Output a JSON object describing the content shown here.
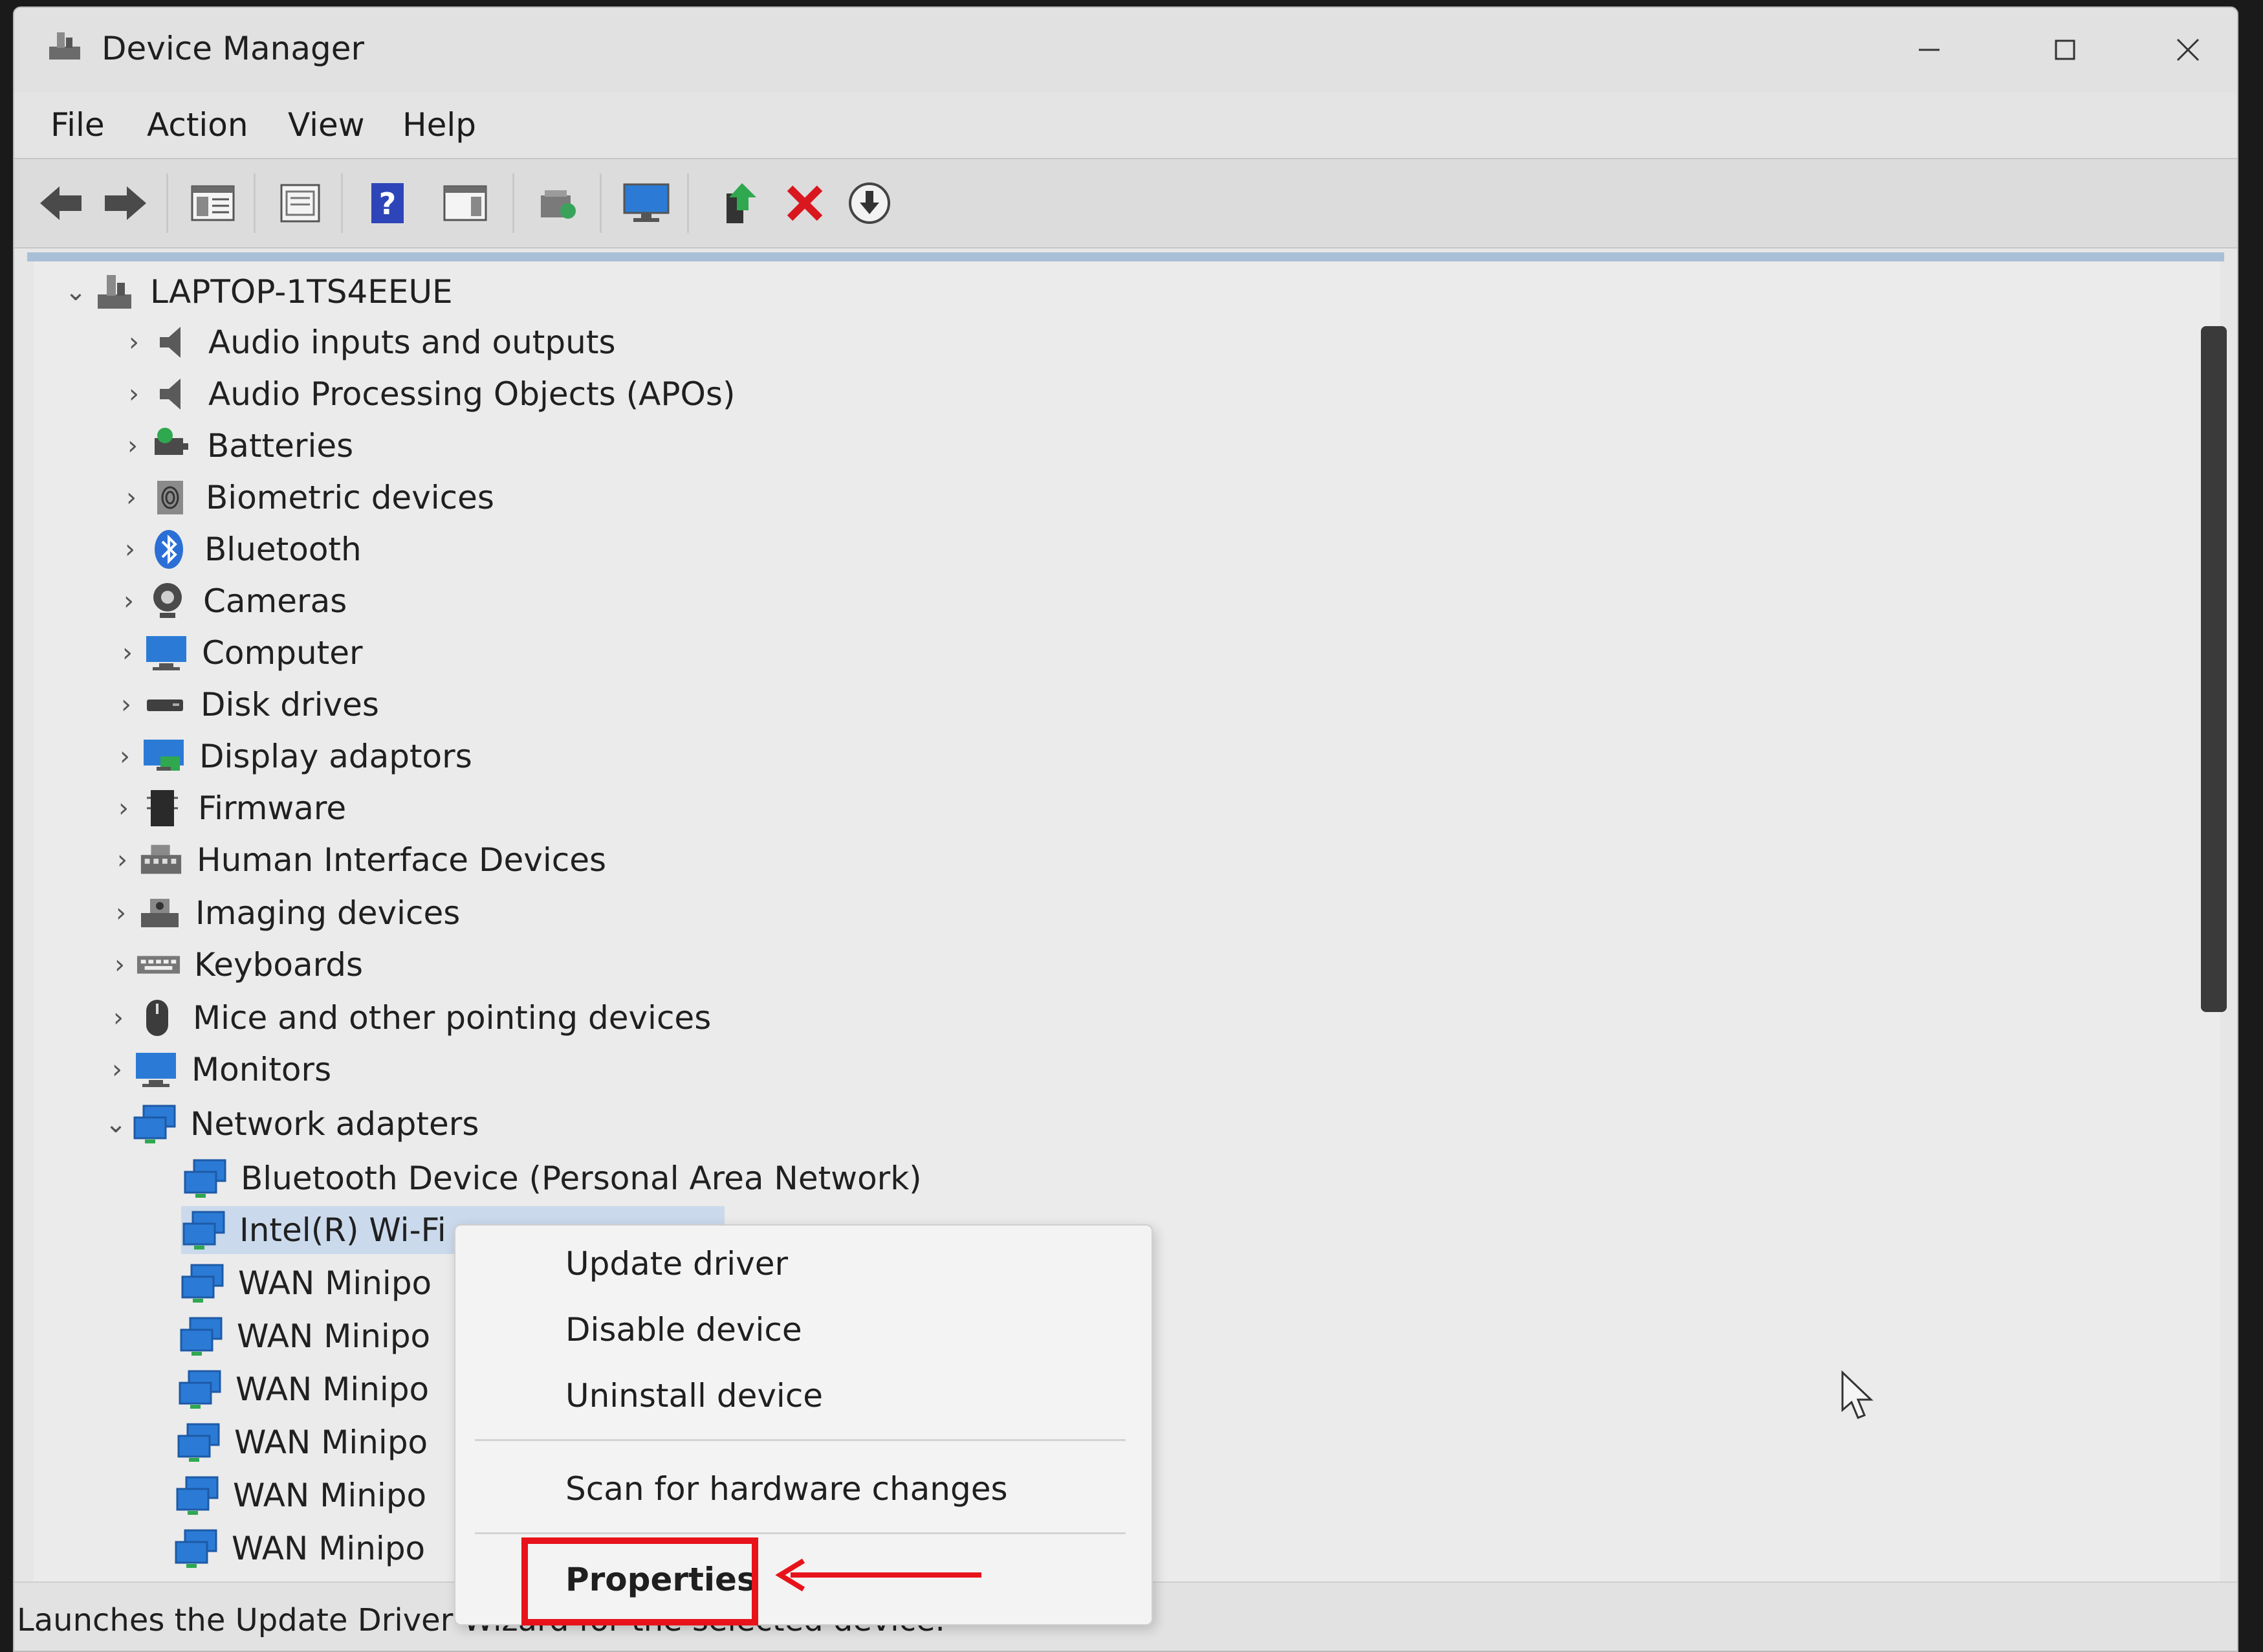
{
  "window": {
    "title": "Device Manager"
  },
  "menu": [
    "File",
    "Action",
    "View",
    "Help"
  ],
  "tree": {
    "root": "LAPTOP-1TS4EEUE",
    "categories": [
      "Audio inputs and outputs",
      "Audio Processing Objects (APOs)",
      "Batteries",
      "Biometric devices",
      "Bluetooth",
      "Cameras",
      "Computer",
      "Disk drives",
      "Display adaptors",
      "Firmware",
      "Human Interface Devices",
      "Imaging devices",
      "Keyboards",
      "Mice and other pointing devices",
      "Monitors",
      "Network adapters"
    ],
    "network_children": [
      "Bluetooth Device (Personal Area Network)",
      "Intel(R) Wi-Fi",
      "WAN Minipo",
      "WAN Minipo",
      "WAN Minipo",
      "WAN Minipo",
      "WAN Minipo",
      "WAN Minipo"
    ]
  },
  "context_menu": {
    "items": [
      "Update driver",
      "Disable device",
      "Uninstall device",
      "Scan for hardware changes",
      "Properties"
    ]
  },
  "status": {
    "text": "Launches the Update Driver Wizard for the selected device."
  },
  "colors": {
    "highlight": "#e8121b",
    "selection": "#cbd9ec",
    "network_icon": "#2b7bd6"
  }
}
